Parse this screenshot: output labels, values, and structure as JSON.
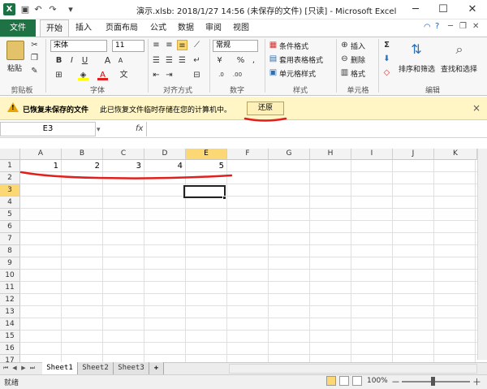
{
  "window": {
    "title": "演示.xlsb: 2018/1/27 14:56 (未保存的文件) [只读] - Microsoft Excel",
    "app_icon": "X",
    "quick_access": [
      "save-icon",
      "undo-icon",
      "redo-icon",
      "customize-icon"
    ],
    "controls": {
      "minimize": "─",
      "maximize": "☐",
      "close": "✕"
    }
  },
  "ribbon": {
    "file_tab": "文件",
    "tabs": [
      "开始",
      "插入",
      "页面布局",
      "公式",
      "数据",
      "审阅",
      "视图"
    ],
    "active_tab": "开始",
    "help_icons": [
      "help-icon",
      "minimize-ribbon-icon",
      "restore-icon",
      "close-icon"
    ],
    "clipboard": {
      "paste": "粘贴",
      "label": "剪贴板"
    },
    "font": {
      "name": "宋体",
      "size": "11",
      "label": "字体",
      "bold": "B",
      "italic": "I",
      "underline": "U",
      "grow": "A",
      "shrink": "A",
      "font_color_glyph": "A",
      "wen": "文"
    },
    "alignment": {
      "label": "对齐方式"
    },
    "number": {
      "format": "常规",
      "label": "数字",
      "percent": "%",
      "comma": ","
    },
    "styles": {
      "conditional": "条件格式",
      "table": "套用表格格式",
      "cell": "单元格样式",
      "label": "样式"
    },
    "cells": {
      "insert": "插入",
      "delete": "删除",
      "format": "格式",
      "label": "单元格"
    },
    "editing": {
      "sort": "排序和筛选",
      "find": "查找和选择",
      "label": "编辑",
      "sum": "Σ"
    }
  },
  "message_bar": {
    "title": "已恢复未保存的文件",
    "text": "此已恢复文件临时存储在您的计算机中。",
    "button": "还原",
    "close": "×"
  },
  "formula_bar": {
    "name_box": "E3",
    "fx": "fx",
    "formula": ""
  },
  "grid": {
    "columns": [
      "A",
      "B",
      "C",
      "D",
      "E",
      "F",
      "G",
      "H",
      "I",
      "J",
      "K"
    ],
    "selected_column": "E",
    "rows": [
      "1",
      "2",
      "3",
      "4",
      "5",
      "6",
      "7",
      "8",
      "9",
      "10",
      "11",
      "12",
      "13",
      "14",
      "15",
      "16",
      "17"
    ],
    "selected_row": "3",
    "active_cell": "E3",
    "row1_values": [
      "1",
      "2",
      "3",
      "4",
      "5"
    ]
  },
  "sheets": {
    "tabs": [
      "Sheet1",
      "Sheet2",
      "Sheet3"
    ],
    "active": "Sheet1"
  },
  "status": {
    "text": "就绪",
    "zoom": "100%",
    "zoom_minus": "－",
    "zoom_plus": "＋"
  },
  "colors": {
    "file_tab": "#1f7244",
    "selection": "#fbd873",
    "message_bar": "#fff5c5",
    "annotation": "#e0201e"
  }
}
